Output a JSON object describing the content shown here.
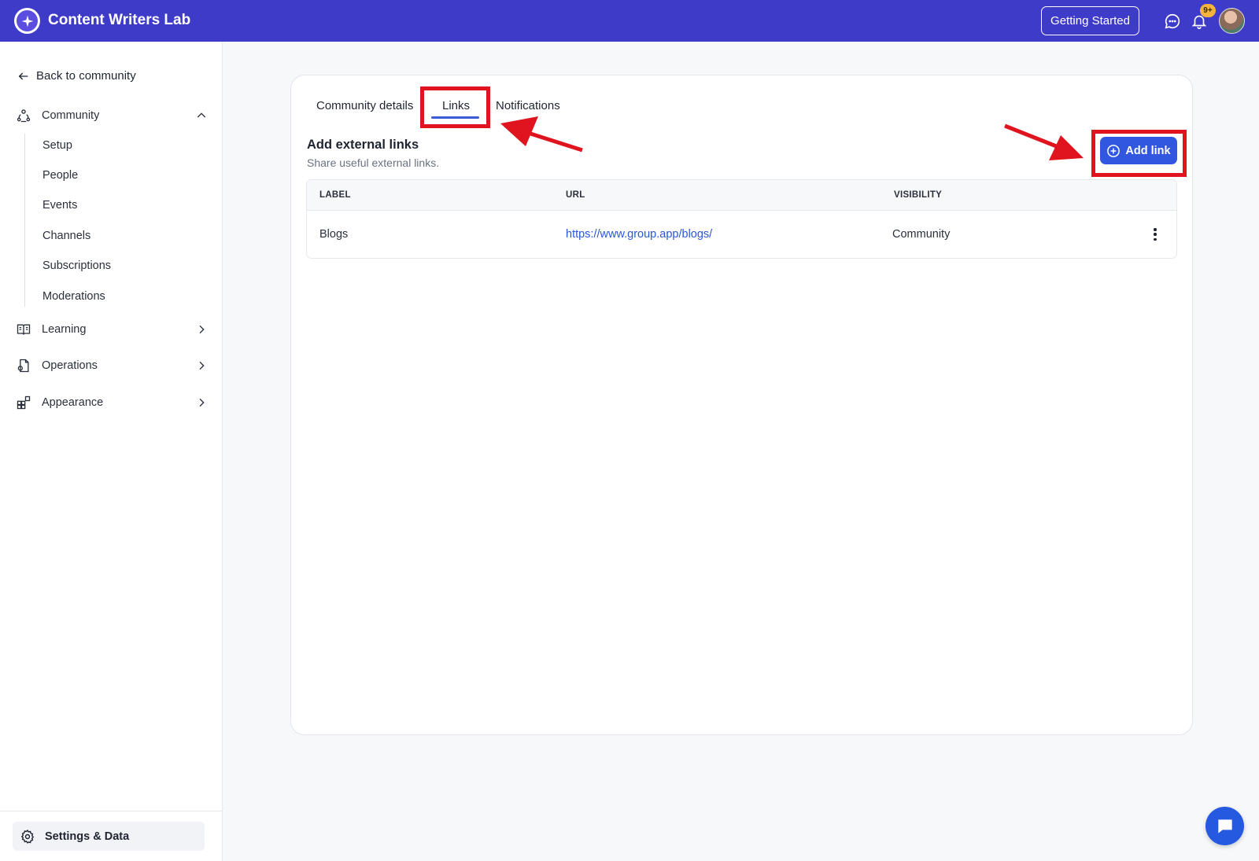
{
  "header": {
    "app_title": "Content Writers Lab",
    "getting_started": "Getting Started",
    "notification_badge": "9+",
    "brand_color": "#3f3bc9",
    "icons": [
      "logo-star-icon",
      "chat-bubble-icon",
      "bell-icon",
      "avatar"
    ]
  },
  "sidebar": {
    "back_label": "Back to community",
    "groups": [
      {
        "label": "Community",
        "icon": "community-icon",
        "expanded": true
      },
      {
        "label": "Learning",
        "icon": "book-icon",
        "expanded": false
      },
      {
        "label": "Operations",
        "icon": "operations-icon",
        "expanded": false
      },
      {
        "label": "Appearance",
        "icon": "appearance-icon",
        "expanded": false
      }
    ],
    "community_items": [
      "Setup",
      "People",
      "Events",
      "Channels",
      "Subscriptions",
      "Moderations"
    ],
    "settings_label": "Settings & Data"
  },
  "tabs": [
    {
      "label": "Community details",
      "active": false
    },
    {
      "label": "Links",
      "active": true
    },
    {
      "label": "Notifications",
      "active": false
    }
  ],
  "section": {
    "title": "Add external links",
    "subtitle": "Share useful external links."
  },
  "add_button": {
    "label": "Add link",
    "color": "#3157e0"
  },
  "table": {
    "headers": [
      "LABEL",
      "URL",
      "VISIBILITY"
    ],
    "rows": [
      {
        "label": "Blogs",
        "url": "https://www.group.app/blogs/",
        "visibility": "Community"
      }
    ]
  },
  "annotation_color": "#e0141e"
}
